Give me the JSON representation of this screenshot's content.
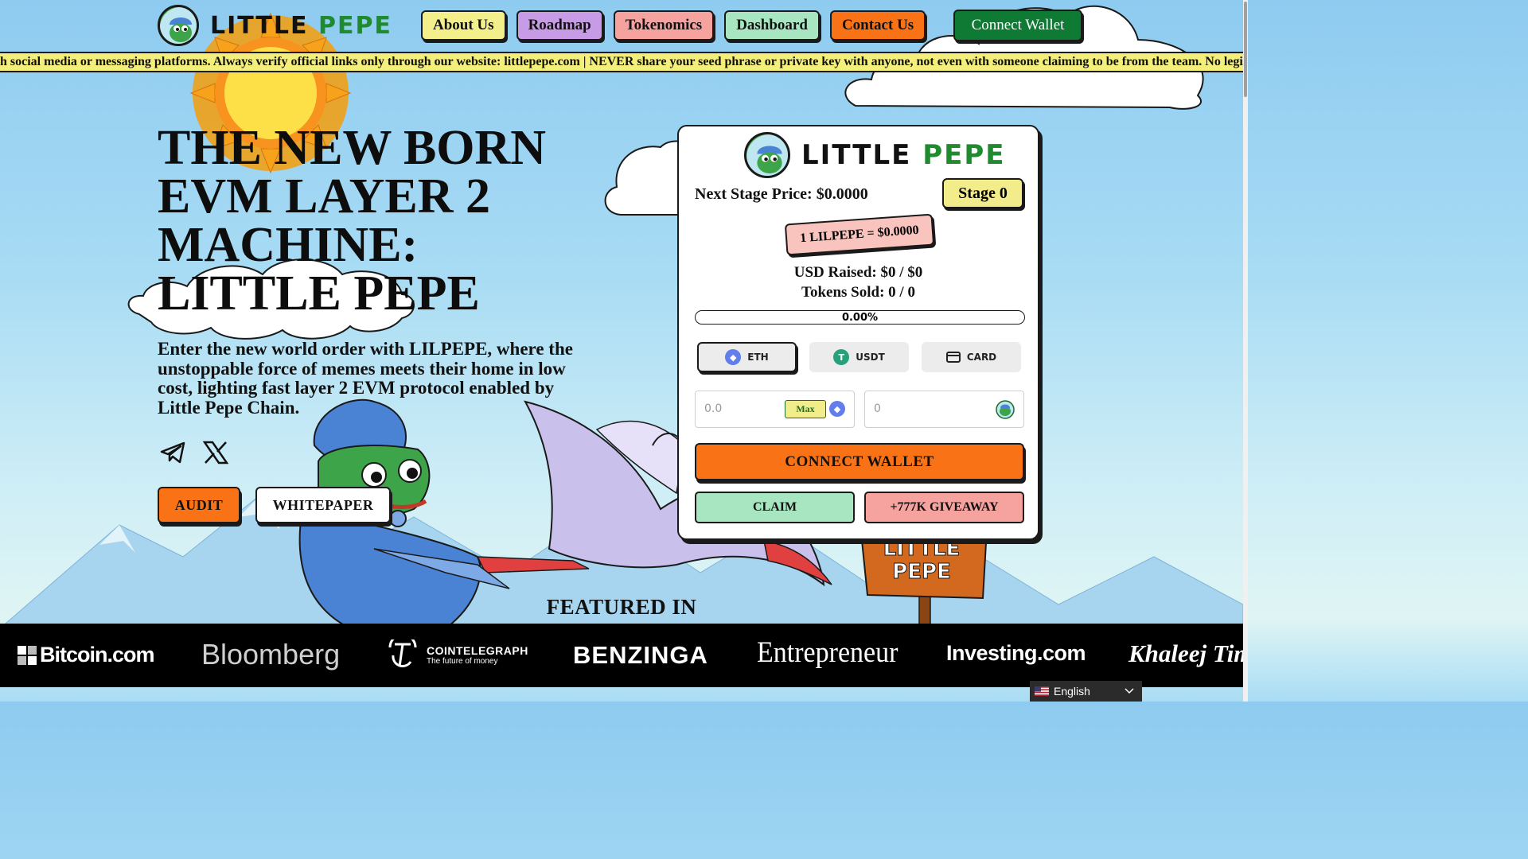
{
  "brand": {
    "word1": "LITTLE",
    "word2": "PEPE"
  },
  "nav": {
    "items": [
      {
        "label": "About Us",
        "color": "#f3ef8a"
      },
      {
        "label": "Roadmap",
        "color": "#c89be6"
      },
      {
        "label": "Tokenomics",
        "color": "#f6a3a0"
      },
      {
        "label": "Dashboard",
        "color": "#a7e6c0"
      },
      {
        "label": "Contact Us",
        "color": "#f97316"
      }
    ],
    "connect_label": "Connect Wallet"
  },
  "ticker": {
    "text": "h social media or messaging platforms. Always verify official links only through our website: littlepepe.com | NEVER share your seed phrase or private key with anyone, not even with someone claiming to be from the team. No legitimate team"
  },
  "hero": {
    "title": "THE NEW BORN EVM LAYER 2 MACHINE: LITTLE PEPE",
    "description": "Enter the new world order with LILPEPE, where the unstoppable force of memes meets their home in low cost, lighting fast layer 2 EVM protocol enabled by Little Pepe Chain.",
    "audit_label": "AUDIT",
    "whitepaper_label": "WHITEPAPER",
    "social": [
      "telegram-icon",
      "x-icon"
    ]
  },
  "scene": {
    "sign_line1": "LITTLE",
    "sign_line2": "PEPE"
  },
  "presale": {
    "next_price": "Next Stage Price: $0.0000",
    "stage": "Stage 0",
    "rate": "1 LILPEPE = $0.0000",
    "usd_raised": "USD Raised: $0 / $0",
    "tokens_sold": "Tokens Sold: 0 / 0",
    "progress_pct": 0,
    "progress_label": "0.00%",
    "tabs": [
      {
        "label": "ETH",
        "icon": "eth-icon",
        "active": true
      },
      {
        "label": "USDT",
        "icon": "usdt-icon",
        "active": false
      },
      {
        "label": "CARD",
        "icon": "card-icon",
        "active": false
      }
    ],
    "pay_value": "0.0",
    "max_label": "Max",
    "receive_value": "0",
    "connect_label": "CONNECT WALLET",
    "claim_label": "CLAIM",
    "giveaway_label": "+777K GIVEAWAY",
    "colors": {
      "claim": "#a7e6c0",
      "giveaway": "#f6a3a0",
      "connect": "#f97316"
    }
  },
  "featured": {
    "title": "FEATURED IN",
    "outlets": [
      "Bitcoin.com",
      "Bloomberg",
      "COINTELEGRAPH",
      "The future of money",
      "BENZINGA",
      "Entrepreneur",
      "Investing.com",
      "Khaleej Times"
    ]
  },
  "language": {
    "label": "English"
  }
}
